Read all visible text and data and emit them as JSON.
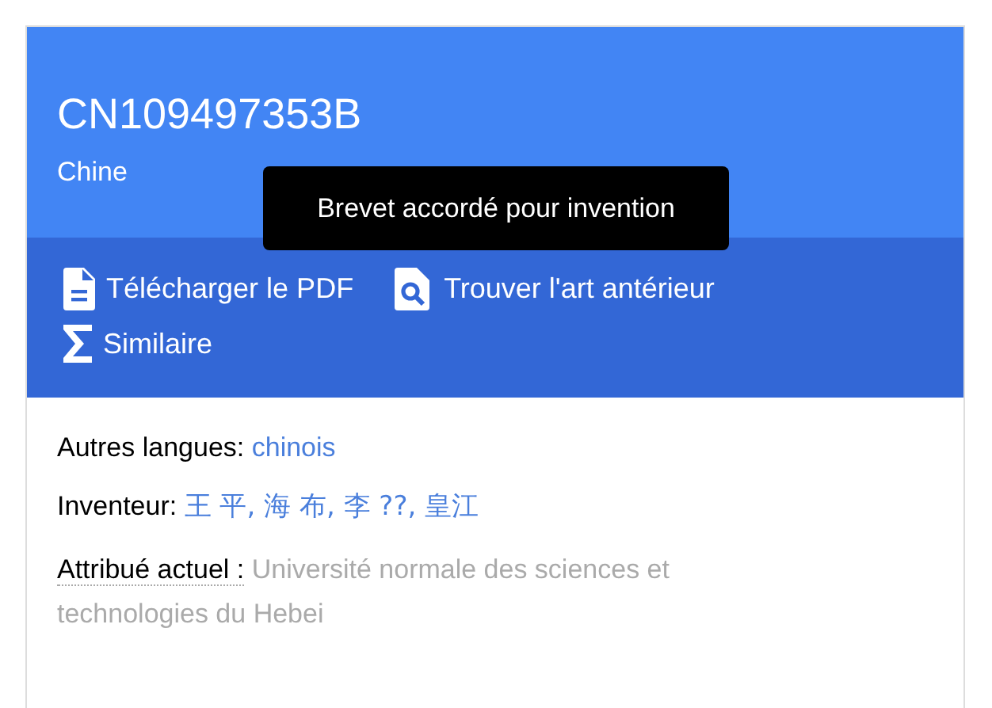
{
  "header": {
    "patent_number": "CN109497353B",
    "country": "Chine"
  },
  "tooltip": {
    "text": "Brevet accordé pour invention"
  },
  "actions": [
    {
      "kind": "pdf",
      "label": "Télécharger le PDF"
    },
    {
      "kind": "prior_art",
      "label": "Trouver l'art antérieur"
    },
    {
      "kind": "similar",
      "label": "Similaire"
    }
  ],
  "details": {
    "other_languages": {
      "label": "Autres langues:",
      "value": "chinois"
    },
    "inventors": {
      "label": "Inventeur:",
      "names": "王 平, 海 布, 李 ??, 皇江"
    },
    "assignee": {
      "label": "Attribué actuel :",
      "value": "Université normale des sciences et technologies du Hebei"
    }
  }
}
